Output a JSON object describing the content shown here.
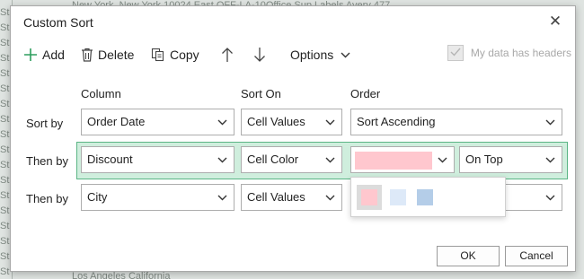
{
  "background": {
    "column_a_text": "St\nSt\nSt\nSt\nSt\nSt\nSt\nSt\nSt\nSt\nSt\nSt\nSt\nSt\nSt\nSt\nSt\nSt",
    "top_row_text": "New York, New York      10024   East            OFF-LA-10Office Sup  Labels        Avery 477",
    "bottom_row_text": "Los Angeles California"
  },
  "dialog": {
    "title": "Custom Sort",
    "close_glyph": "✕"
  },
  "toolbar": {
    "add_label": "Add",
    "delete_label": "Delete",
    "copy_label": "Copy",
    "options_label": "Options",
    "headers_label": "My data has headers"
  },
  "columns": {
    "column": "Column",
    "sort_on": "Sort On",
    "order": "Order"
  },
  "rows": [
    {
      "label": "Sort by",
      "column": "Order Date",
      "sort_on": "Cell Values",
      "order": "Sort Ascending"
    },
    {
      "label": "Then by",
      "column": "Discount",
      "sort_on": "Cell Color",
      "order_color": "#ffc7ce",
      "position": "On Top"
    },
    {
      "label": "Then by",
      "column": "City",
      "sort_on": "Cell Values",
      "order": ""
    }
  ],
  "color_options": [
    {
      "name": "pink",
      "color": "#ffc7ce",
      "selected": true
    },
    {
      "name": "light-blue",
      "color": "#dde9f8",
      "selected": false
    },
    {
      "name": "blue",
      "color": "#b4cde8",
      "selected": false
    }
  ],
  "buttons": {
    "ok": "OK",
    "cancel": "Cancel"
  },
  "colors": {
    "accent_green": "#2e9e5e",
    "row_highlight": "#cfeedd"
  }
}
